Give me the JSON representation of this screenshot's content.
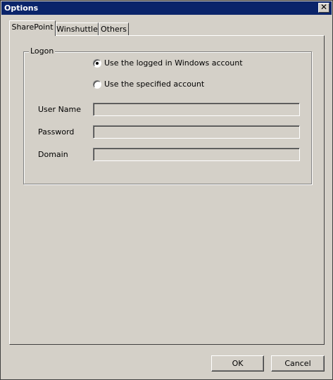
{
  "window": {
    "title": "Options",
    "close_glyph": "✕"
  },
  "tabs": [
    {
      "label": "SharePoint",
      "active": true
    },
    {
      "label": "Winshuttle",
      "active": false
    },
    {
      "label": "Others",
      "active": false
    }
  ],
  "logon_group": {
    "title": "Logon",
    "radio_windows_label": "Use the logged in Windows account",
    "radio_windows_checked": true,
    "radio_specified_label": "Use the specified account",
    "radio_specified_checked": false,
    "fields": [
      {
        "label": "User Name",
        "value": ""
      },
      {
        "label": "Password",
        "value": ""
      },
      {
        "label": "Domain",
        "value": ""
      }
    ]
  },
  "buttons": {
    "ok_label": "OK",
    "cancel_label": "Cancel"
  },
  "colors": {
    "dialog_face": "#d4d0c8",
    "titlebar": "#0a246a",
    "titlebar_text": "#ffffff"
  }
}
